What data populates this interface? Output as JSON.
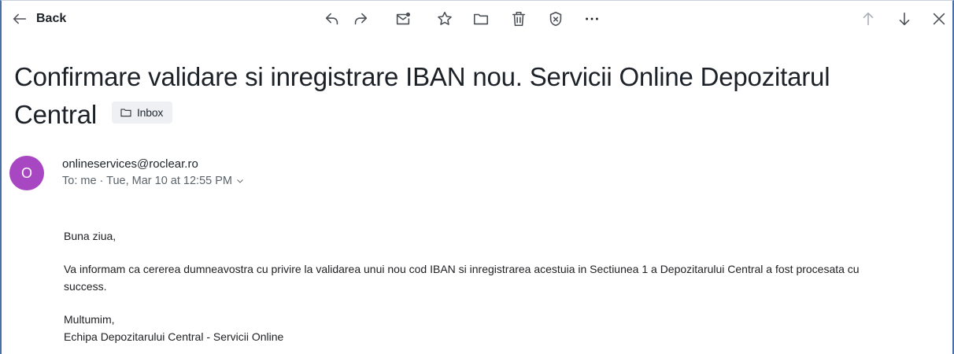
{
  "toolbar": {
    "back_label": "Back",
    "actions": [
      "reply-icon",
      "forward-icon",
      "mark-unread-icon",
      "star-icon",
      "folder-icon",
      "trash-icon",
      "spam-icon",
      "more-icon"
    ],
    "nav": [
      "arrow-up-icon",
      "arrow-down-icon",
      "close-icon"
    ]
  },
  "email": {
    "subject": "Confirmare validare si inregistrare IBAN nou. Servicii Online Depozitarul Central",
    "folder_label": "Inbox",
    "avatar_letter": "O",
    "sender": "onlineservices@roclear.ro",
    "meta": "To: me · Tue, Mar 10 at 12:55 PM",
    "body": {
      "greeting": "Buna ziua,",
      "message": "Va informam ca cererea dumneavostra cu privire la validarea unui nou cod IBAN si inregistrarea acestuia in Sectiunea 1 a Depozitarului Central a fost procesata cu success.",
      "closing": "Multumim,",
      "signature": "Echipa Depozitarului Central - Servicii Online"
    }
  },
  "colors": {
    "avatar": "#a847c2",
    "folder_chip_bg": "#eef0f3",
    "window_border": "#4a6fa5"
  }
}
